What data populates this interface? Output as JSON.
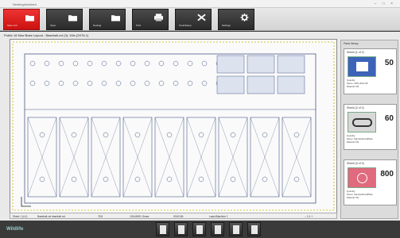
{
  "window": {
    "title": "NestingAssistant",
    "controls": "– □ ×"
  },
  "toolbar": {
    "buttons": [
      {
        "label": "Save Job",
        "icon": "folder-icon",
        "active": true
      },
      {
        "label": "Open",
        "icon": "folder-icon",
        "active": false
      },
      {
        "label": "Nesting",
        "icon": "folder-icon",
        "active": false
      },
      {
        "label": "Print",
        "icon": "print-icon",
        "active": false
      },
      {
        "label": "Tools/Setup",
        "icon": "tools-icon",
        "active": false
      },
      {
        "label": "Settings",
        "icon": "gear-icon",
        "active": false
      }
    ]
  },
  "document": {
    "title": "Public 18 New Base Layout - Baseball.cxt (3): 16in (3X76.1)"
  },
  "status": {
    "sheet": "Sheet 1 (4:1)",
    "file": "Baseball.cxt baseball.cxt",
    "count": "78 8",
    "size": "132x28/91 Grass",
    "number": "0010106",
    "mode": "Laser/Machine 1",
    "zoom": "-- 1:1 +"
  },
  "parts_panel": {
    "title": "Parts library",
    "cards": [
      {
        "name": "Shield (1 of 2)",
        "count": "50",
        "meta": [
          "Quantity",
          "Name: CMS 2021-08",
          "Material: PE"
        ],
        "thumb_color": "#3c63b8"
      },
      {
        "name": "Shield (2 of 2)",
        "count": "60",
        "meta": [
          "Quantity",
          "Name: StandardCardPlate",
          "Material: PE"
        ],
        "thumb_color": "#d8d8d8"
      },
      {
        "name": "Shield (3 of 3)",
        "count": "800",
        "meta": [
          "Quantity",
          "Name: StandardCardPlate",
          "Material: PE"
        ],
        "thumb_color": "#e06a7e"
      }
    ]
  },
  "bottom_bar": {
    "logo": "Wildlife",
    "buttons": [
      "doc-open-icon",
      "doc-icon",
      "doc-icon",
      "doc-import-icon",
      "save-icon",
      "doc-export-icon"
    ]
  },
  "colors": {
    "accent": "#d62020",
    "toolbar_dark": "#2e2e2e",
    "drawing_line": "#4a5a8a"
  }
}
